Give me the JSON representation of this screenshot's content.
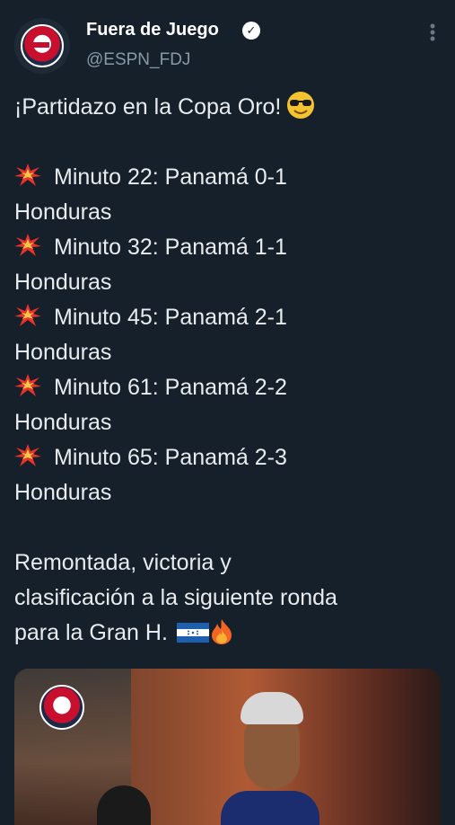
{
  "header": {
    "display_name": "Fuera de Juego",
    "handle": "@ESPN_FDJ",
    "verified_mark": "✓",
    "more_glyph": "⋮"
  },
  "tweet": {
    "intro": "¡Partidazo en la Copa Oro!",
    "goals": [
      {
        "line1": "Minuto 22: Panamá 0-1",
        "line2": "Honduras"
      },
      {
        "line1": "Minuto 32: Panamá 1-1",
        "line2": "Honduras"
      },
      {
        "line1": "Minuto 45: Panamá 2-1",
        "line2": "Honduras"
      },
      {
        "line1": "Minuto 61: Panamá 2-2",
        "line2": "Honduras"
      },
      {
        "line1": "Minuto 65: Panamá 2-3",
        "line2": "Honduras"
      }
    ],
    "closing": [
      "Remontada, victoria y",
      "clasificación a la siguiente ronda",
      "para la Gran H."
    ]
  },
  "icons": {
    "avatar": "espn-fuera-de-juego-logo",
    "verified": "verified-badge-icon",
    "more": "more-options-icon",
    "goal_marker": "collision-emoji-icon",
    "intro_emoji": "sunglasses-emoji-icon",
    "flag": "honduras-flag-icon",
    "fire": "fire-emoji-icon"
  },
  "colors": {
    "background": "#15202b",
    "text": "#e8ecef",
    "handle": "#8899a6"
  }
}
